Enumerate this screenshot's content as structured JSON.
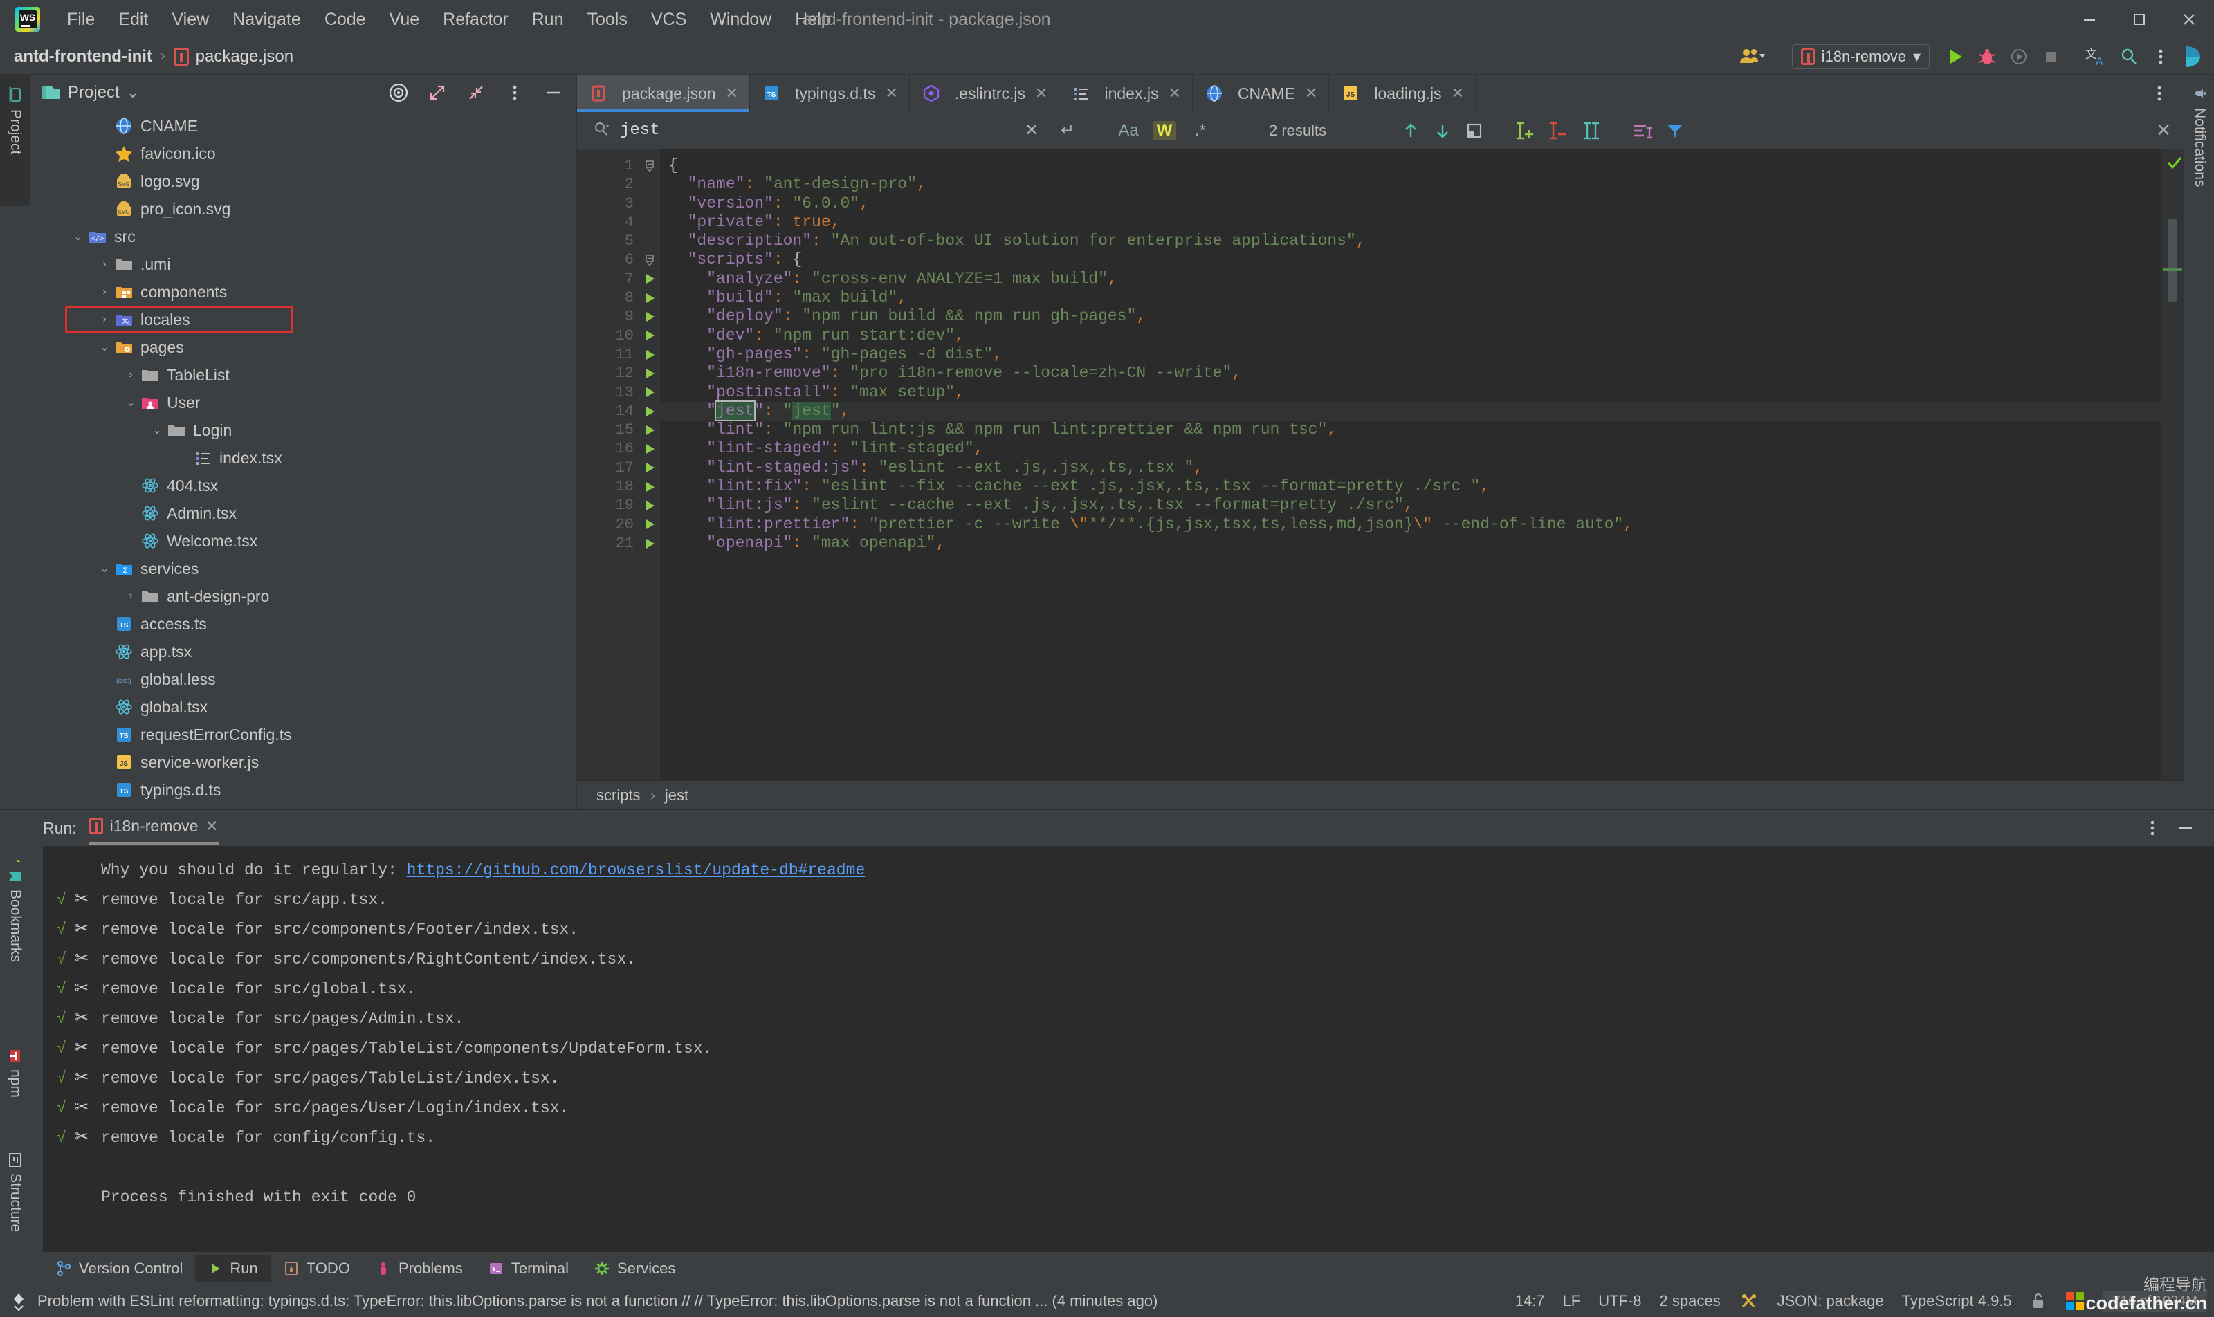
{
  "window": {
    "title": "antd-frontend-init - package.json",
    "minimize": "–",
    "maximize": "❐",
    "close": "✕"
  },
  "menu": {
    "items": [
      "File",
      "Edit",
      "View",
      "Navigate",
      "Code",
      "Vue",
      "Refactor",
      "Run",
      "Tools",
      "VCS",
      "Window",
      "Help"
    ]
  },
  "breadcrumb": {
    "project": "antd-frontend-init",
    "separator": "›",
    "file": "package.json"
  },
  "toolbar": {
    "run_config": "i18n-remove",
    "chevron": "▾",
    "run_label": "Run",
    "debug_label": "Debug",
    "coverage_label": "Run with Coverage",
    "stop_label": "Stop",
    "translate_label": "Translate",
    "search_label": "Search Everywhere",
    "more_label": "More"
  },
  "project_panel": {
    "title": "Project",
    "chevron": "⌄",
    "locate_label": "Select Opened File",
    "expand_label": "Expand All",
    "collapse_label": "Collapse All",
    "options_label": "Options",
    "hide_label": "Hide",
    "tree": [
      {
        "label": "CNAME",
        "indent": 1,
        "arrow": "",
        "icon": "globe",
        "selected": false
      },
      {
        "label": "favicon.ico",
        "indent": 1,
        "arrow": "",
        "icon": "star",
        "selected": false
      },
      {
        "label": "logo.svg",
        "indent": 1,
        "arrow": "",
        "icon": "svg",
        "selected": false
      },
      {
        "label": "pro_icon.svg",
        "indent": 1,
        "arrow": "",
        "icon": "svg",
        "selected": false
      },
      {
        "label": "src",
        "indent": 0,
        "arrow": "⌄",
        "icon": "srcfolder",
        "selected": false
      },
      {
        "label": ".umi",
        "indent": 1,
        "arrow": "›",
        "icon": "folder",
        "selected": false
      },
      {
        "label": "components",
        "indent": 1,
        "arrow": "›",
        "icon": "compfolder",
        "selected": false
      },
      {
        "label": "locales",
        "indent": 1,
        "arrow": "›",
        "icon": "localefolder",
        "selected": true
      },
      {
        "label": "pages",
        "indent": 1,
        "arrow": "⌄",
        "icon": "pagefolder",
        "selected": false
      },
      {
        "label": "TableList",
        "indent": 2,
        "arrow": "›",
        "icon": "folder",
        "selected": false
      },
      {
        "label": "User",
        "indent": 2,
        "arrow": "⌄",
        "icon": "userfolder",
        "selected": false
      },
      {
        "label": "Login",
        "indent": 3,
        "arrow": "⌄",
        "icon": "folder",
        "selected": false
      },
      {
        "label": "index.tsx",
        "indent": 4,
        "arrow": "",
        "icon": "list",
        "selected": false
      },
      {
        "label": "404.tsx",
        "indent": 2,
        "arrow": "",
        "icon": "react",
        "selected": false
      },
      {
        "label": "Admin.tsx",
        "indent": 2,
        "arrow": "",
        "icon": "react",
        "selected": false
      },
      {
        "label": "Welcome.tsx",
        "indent": 2,
        "arrow": "",
        "icon": "react",
        "selected": false
      },
      {
        "label": "services",
        "indent": 1,
        "arrow": "⌄",
        "icon": "svcfolder",
        "selected": false
      },
      {
        "label": "ant-design-pro",
        "indent": 2,
        "arrow": "›",
        "icon": "folder",
        "selected": false
      },
      {
        "label": "access.ts",
        "indent": 1,
        "arrow": "",
        "icon": "ts",
        "selected": false
      },
      {
        "label": "app.tsx",
        "indent": 1,
        "arrow": "",
        "icon": "react",
        "selected": false
      },
      {
        "label": "global.less",
        "indent": 1,
        "arrow": "",
        "icon": "less",
        "selected": false
      },
      {
        "label": "global.tsx",
        "indent": 1,
        "arrow": "",
        "icon": "react",
        "selected": false
      },
      {
        "label": "requestErrorConfig.ts",
        "indent": 1,
        "arrow": "",
        "icon": "ts",
        "selected": false
      },
      {
        "label": "service-worker.js",
        "indent": 1,
        "arrow": "",
        "icon": "js",
        "selected": false
      },
      {
        "label": "typings.d.ts",
        "indent": 1,
        "arrow": "",
        "icon": "ts",
        "selected": false
      }
    ]
  },
  "editor": {
    "tabs": [
      {
        "label": "package.json",
        "icon": "json",
        "active": true
      },
      {
        "label": "typings.d.ts",
        "icon": "ts",
        "active": false
      },
      {
        "label": ".eslintrc.js",
        "icon": "eslint",
        "active": false
      },
      {
        "label": "index.js",
        "icon": "list",
        "active": false
      },
      {
        "label": "CNAME",
        "icon": "globe",
        "active": false
      },
      {
        "label": "loading.js",
        "icon": "js",
        "active": false
      }
    ],
    "tab_close": "✕",
    "breadcrumbs": [
      "scripts",
      "jest"
    ],
    "breadcrumb_sep": "›",
    "first_line": 1,
    "lines": [
      {
        "n": 1,
        "run": false,
        "fold": "start",
        "current": false,
        "tokens": [
          {
            "t": "{",
            "c": "b"
          }
        ]
      },
      {
        "n": 2,
        "run": false,
        "fold": "",
        "current": false,
        "tokens": [
          {
            "t": "  \"name\"",
            "c": "k"
          },
          {
            "t": ": ",
            "c": "p"
          },
          {
            "t": "\"ant-design-pro\"",
            "c": "s"
          },
          {
            "t": ",",
            "c": "p"
          }
        ]
      },
      {
        "n": 3,
        "run": false,
        "fold": "",
        "current": false,
        "tokens": [
          {
            "t": "  \"version\"",
            "c": "k"
          },
          {
            "t": ": ",
            "c": "p"
          },
          {
            "t": "\"6.0.0\"",
            "c": "s"
          },
          {
            "t": ",",
            "c": "p"
          }
        ]
      },
      {
        "n": 4,
        "run": false,
        "fold": "",
        "current": false,
        "tokens": [
          {
            "t": "  \"private\"",
            "c": "k"
          },
          {
            "t": ": ",
            "c": "p"
          },
          {
            "t": "true",
            "c": "kw"
          },
          {
            "t": ",",
            "c": "p"
          }
        ]
      },
      {
        "n": 5,
        "run": false,
        "fold": "",
        "current": false,
        "tokens": [
          {
            "t": "  \"description\"",
            "c": "k"
          },
          {
            "t": ": ",
            "c": "p"
          },
          {
            "t": "\"An out-of-box UI solution for enterprise applications\"",
            "c": "s"
          },
          {
            "t": ",",
            "c": "p"
          }
        ]
      },
      {
        "n": 6,
        "run": false,
        "fold": "start",
        "current": false,
        "tokens": [
          {
            "t": "  \"scripts\"",
            "c": "k"
          },
          {
            "t": ": ",
            "c": "p"
          },
          {
            "t": "{",
            "c": "b"
          }
        ]
      },
      {
        "n": 7,
        "run": true,
        "fold": "",
        "current": false,
        "tokens": [
          {
            "t": "    \"analyze\"",
            "c": "k"
          },
          {
            "t": ": ",
            "c": "p"
          },
          {
            "t": "\"cross-env ANALYZE=1 max build\"",
            "c": "s"
          },
          {
            "t": ",",
            "c": "p"
          }
        ]
      },
      {
        "n": 8,
        "run": true,
        "fold": "",
        "current": false,
        "tokens": [
          {
            "t": "    \"build\"",
            "c": "k"
          },
          {
            "t": ": ",
            "c": "p"
          },
          {
            "t": "\"max build\"",
            "c": "s"
          },
          {
            "t": ",",
            "c": "p"
          }
        ]
      },
      {
        "n": 9,
        "run": true,
        "fold": "",
        "current": false,
        "tokens": [
          {
            "t": "    \"deploy\"",
            "c": "k"
          },
          {
            "t": ": ",
            "c": "p"
          },
          {
            "t": "\"npm run build && npm run gh-pages\"",
            "c": "s"
          },
          {
            "t": ",",
            "c": "p"
          }
        ]
      },
      {
        "n": 10,
        "run": true,
        "fold": "",
        "current": false,
        "tokens": [
          {
            "t": "    \"dev\"",
            "c": "k"
          },
          {
            "t": ": ",
            "c": "p"
          },
          {
            "t": "\"npm run start:dev\"",
            "c": "s"
          },
          {
            "t": ",",
            "c": "p"
          }
        ]
      },
      {
        "n": 11,
        "run": true,
        "fold": "",
        "current": false,
        "tokens": [
          {
            "t": "    \"gh-pages\"",
            "c": "k"
          },
          {
            "t": ": ",
            "c": "p"
          },
          {
            "t": "\"gh-pages -d dist\"",
            "c": "s"
          },
          {
            "t": ",",
            "c": "p"
          }
        ]
      },
      {
        "n": 12,
        "run": true,
        "fold": "",
        "current": false,
        "tokens": [
          {
            "t": "    \"i18n-remove\"",
            "c": "k"
          },
          {
            "t": ": ",
            "c": "p"
          },
          {
            "t": "\"pro i18n-remove --locale=zh-CN --write\"",
            "c": "s"
          },
          {
            "t": ",",
            "c": "p"
          }
        ]
      },
      {
        "n": 13,
        "run": true,
        "fold": "",
        "current": false,
        "tokens": [
          {
            "t": "    \"postinstall\"",
            "c": "k"
          },
          {
            "t": ": ",
            "c": "p"
          },
          {
            "t": "\"max setup\"",
            "c": "s"
          },
          {
            "t": ",",
            "c": "p"
          }
        ]
      },
      {
        "n": 14,
        "run": true,
        "fold": "",
        "current": true,
        "tokens": [
          {
            "t": "    \"",
            "c": "k"
          },
          {
            "t": "jest",
            "c": "k hl-cur"
          },
          {
            "t": "\"",
            "c": "k"
          },
          {
            "t": ": ",
            "c": "p"
          },
          {
            "t": "\"",
            "c": "s"
          },
          {
            "t": "jest",
            "c": "s hl"
          },
          {
            "t": "\"",
            "c": "s"
          },
          {
            "t": ",",
            "c": "p"
          }
        ]
      },
      {
        "n": 15,
        "run": true,
        "fold": "",
        "current": false,
        "tokens": [
          {
            "t": "    \"lint\"",
            "c": "k"
          },
          {
            "t": ": ",
            "c": "p"
          },
          {
            "t": "\"npm run lint:js && npm run lint:prettier && npm run tsc\"",
            "c": "s"
          },
          {
            "t": ",",
            "c": "p"
          }
        ]
      },
      {
        "n": 16,
        "run": true,
        "fold": "",
        "current": false,
        "tokens": [
          {
            "t": "    \"lint-staged\"",
            "c": "k"
          },
          {
            "t": ": ",
            "c": "p"
          },
          {
            "t": "\"lint-staged\"",
            "c": "s"
          },
          {
            "t": ",",
            "c": "p"
          }
        ]
      },
      {
        "n": 17,
        "run": true,
        "fold": "",
        "current": false,
        "tokens": [
          {
            "t": "    \"lint-staged:js\"",
            "c": "k"
          },
          {
            "t": ": ",
            "c": "p"
          },
          {
            "t": "\"eslint --ext .js,.jsx,.ts,.tsx \"",
            "c": "s"
          },
          {
            "t": ",",
            "c": "p"
          }
        ]
      },
      {
        "n": 18,
        "run": true,
        "fold": "",
        "current": false,
        "tokens": [
          {
            "t": "    \"lint:fix\"",
            "c": "k"
          },
          {
            "t": ": ",
            "c": "p"
          },
          {
            "t": "\"eslint --fix --cache --ext .js,.jsx,.ts,.tsx --format=pretty ./src \"",
            "c": "s"
          },
          {
            "t": ",",
            "c": "p"
          }
        ]
      },
      {
        "n": 19,
        "run": true,
        "fold": "",
        "current": false,
        "tokens": [
          {
            "t": "    \"lint:js\"",
            "c": "k"
          },
          {
            "t": ": ",
            "c": "p"
          },
          {
            "t": "\"eslint --cache --ext .js,.jsx,.ts,.tsx --format=pretty ./src\"",
            "c": "s"
          },
          {
            "t": ",",
            "c": "p"
          }
        ]
      },
      {
        "n": 20,
        "run": true,
        "fold": "",
        "current": false,
        "tokens": [
          {
            "t": "    \"lint:prettier\"",
            "c": "k"
          },
          {
            "t": ": ",
            "c": "p"
          },
          {
            "t": "\"prettier -c --write ",
            "c": "s"
          },
          {
            "t": "\\\"",
            "c": "esc"
          },
          {
            "t": "**/**.{js,jsx,tsx,ts,less,md,json}",
            "c": "s"
          },
          {
            "t": "\\\"",
            "c": "esc"
          },
          {
            "t": " --end-of-line auto\"",
            "c": "s"
          },
          {
            "t": ",",
            "c": "p"
          }
        ]
      },
      {
        "n": 21,
        "run": true,
        "fold": "",
        "current": false,
        "tokens": [
          {
            "t": "    \"openapi\"",
            "c": "k"
          },
          {
            "t": ": ",
            "c": "p"
          },
          {
            "t": "\"max openapi\"",
            "c": "s"
          },
          {
            "t": ",",
            "c": "p"
          }
        ]
      }
    ]
  },
  "find": {
    "query": "jest",
    "placeholder": "Search",
    "clear": "✕",
    "newline": "↵",
    "match_case": "Aa",
    "words": "W",
    "regex": ".*",
    "results": "2 results",
    "prev": "↑",
    "next": "↓",
    "select_all": "Select All Occurrences",
    "add_selection": "Add Selection",
    "remove_selection": "Remove Selection",
    "multi_cursor": "Multiple Cursors",
    "in_selection": "In Selection",
    "filter": "Filter",
    "close": "✕"
  },
  "run_panel": {
    "label": "Run:",
    "tab": "i18n-remove",
    "tab_close": "✕",
    "rerun": "Rerun",
    "more": "More",
    "hide": "–",
    "output": [
      {
        "check": false,
        "scissors": false,
        "prefix": "",
        "text": "Why you should do it regularly: ",
        "link": "https://github.com/browserslist/update-db#readme"
      },
      {
        "check": true,
        "scissors": true,
        "text": "remove locale for src/app.tsx."
      },
      {
        "check": true,
        "scissors": true,
        "text": "remove locale for src/components/Footer/index.tsx."
      },
      {
        "check": true,
        "scissors": true,
        "text": "remove locale for src/components/RightContent/index.tsx."
      },
      {
        "check": true,
        "scissors": true,
        "text": "remove locale for src/global.tsx."
      },
      {
        "check": true,
        "scissors": true,
        "text": "remove locale for src/pages/Admin.tsx."
      },
      {
        "check": true,
        "scissors": true,
        "text": "remove locale for src/pages/TableList/components/UpdateForm.tsx."
      },
      {
        "check": true,
        "scissors": true,
        "text": "remove locale for src/pages/TableList/index.tsx."
      },
      {
        "check": true,
        "scissors": true,
        "text": "remove locale for src/pages/User/Login/index.tsx."
      },
      {
        "check": true,
        "scissors": true,
        "text": "remove locale for config/config.ts."
      },
      {
        "check": false,
        "scissors": false,
        "text": ""
      },
      {
        "check": false,
        "scissors": false,
        "text": "Process finished with exit code 0"
      }
    ]
  },
  "left_strip": {
    "tabs": [
      "Project"
    ]
  },
  "right_strip": {
    "tabs": [
      "Notifications"
    ]
  },
  "side_strip_left_bottom": {
    "tabs": [
      "Bookmarks",
      "npm",
      "Structure"
    ]
  },
  "tool_windows": {
    "items": [
      {
        "label": "Version Control",
        "icon": "branch",
        "active": false
      },
      {
        "label": "Run",
        "icon": "play",
        "active": true
      },
      {
        "label": "TODO",
        "icon": "todo",
        "active": false
      },
      {
        "label": "Problems",
        "icon": "problems",
        "active": false
      },
      {
        "label": "Terminal",
        "icon": "terminal",
        "active": false
      },
      {
        "label": "Services",
        "icon": "services",
        "active": false
      }
    ]
  },
  "status_bar": {
    "message": "Problem with ESLint reformatting: typings.d.ts: TypeError: this.libOptions.parse is not a function // // TypeError: this.libOptions.parse is not a function  ... (4 minutes ago)",
    "caret": "14:7",
    "line_sep": "LF",
    "encoding": "UTF-8",
    "indent": "2 spaces",
    "schema": "JSON: package",
    "typescript": "TypeScript 4.9.5",
    "memory": "716 of 1024M"
  },
  "watermark": {
    "cn": "编程导航",
    "domain": "codefather.cn"
  },
  "colors": {
    "bg_chrome": "#3c3f41",
    "bg_editor": "#2b2b2b",
    "accent_tab": "#3e86d6",
    "string": "#6a8759",
    "key": "#9876aa",
    "punct": "#cc7832",
    "match_hl": "#32593d",
    "selection_box": "#e03030",
    "link": "#589df6"
  }
}
